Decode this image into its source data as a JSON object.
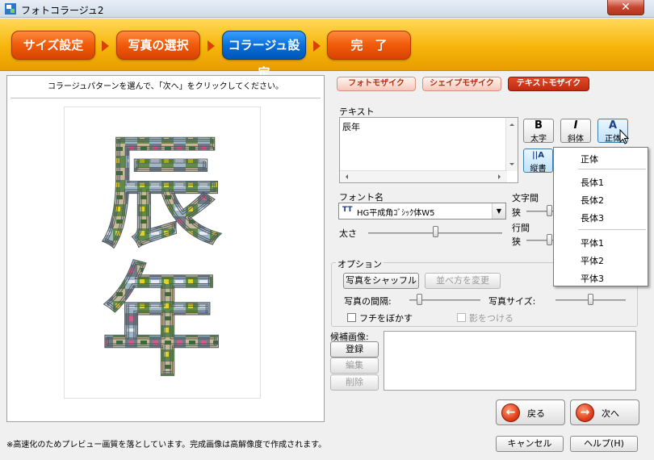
{
  "window": {
    "title": "フォトコラージュ2",
    "close_glyph": "✕"
  },
  "steps": [
    {
      "label": "サイズ設定"
    },
    {
      "label": "写真の選択"
    },
    {
      "label": "コラージュ設定"
    },
    {
      "label": "完　了"
    }
  ],
  "preview": {
    "instruction": "コラージュパターンを選んで、「次へ」をクリックしてください。",
    "collage_text": "辰年"
  },
  "mosaic_tabs": [
    {
      "label": "フォトモザイク",
      "selected": false
    },
    {
      "label": "シェイプモザイク",
      "selected": false
    },
    {
      "label": "テキストモザイク",
      "selected": true
    }
  ],
  "text_section": {
    "label": "テキスト",
    "value": "辰年",
    "bold": {
      "glyph": "B",
      "label": "太字"
    },
    "italic": {
      "glyph": "I",
      "label": "斜体"
    },
    "shape": {
      "glyph": "A",
      "label": "正体"
    },
    "vertical": {
      "glyph": "||A",
      "label": "縦書"
    }
  },
  "font": {
    "label": "フォント名",
    "value": "HG平成角ｺﾞｼｯｸ体W5",
    "tt_glyph": "TT",
    "weight_label": "太さ",
    "weight_value": 0.48,
    "char_spacing_label": "文字間",
    "char_spacing_min": "狭",
    "line_spacing_label": "行間",
    "line_spacing_min": "狭"
  },
  "options": {
    "label": "オプション",
    "shuffle_button": "写真をシャッフル",
    "reorder_button": "並べ方を変更",
    "gap_label": "写真の間隔:",
    "gap_value": 0.2,
    "size_label": "写真サイズ:",
    "size_value": 0.5,
    "blur_edge_label": "フチをぼかす",
    "blur_edge_checked": false,
    "shadow_label": "影をつける",
    "shadow_checked": false
  },
  "candidates": {
    "label": "候補画像:",
    "register_button": "登録",
    "edit_button": "編集",
    "delete_button": "削除"
  },
  "nav": {
    "back_label": "戻る",
    "next_label": "次へ",
    "cancel_label": "キャンセル",
    "help_label": "ヘルプ(H)"
  },
  "footer_note": "※高速化のためプレビュー画質を落としています。完成画像は高解像度で作成されます。",
  "shape_menu": {
    "items": [
      "正体",
      "長体1",
      "長体2",
      "長体3",
      "平体1",
      "平体2",
      "平体3"
    ]
  },
  "colors": {
    "step_orange": "#ef5a0a",
    "step_active_blue": "#0a6fd8",
    "step_bar": "#f7b50a",
    "tab_selected": "#c02a10",
    "nav_circle": "#e0401c"
  }
}
